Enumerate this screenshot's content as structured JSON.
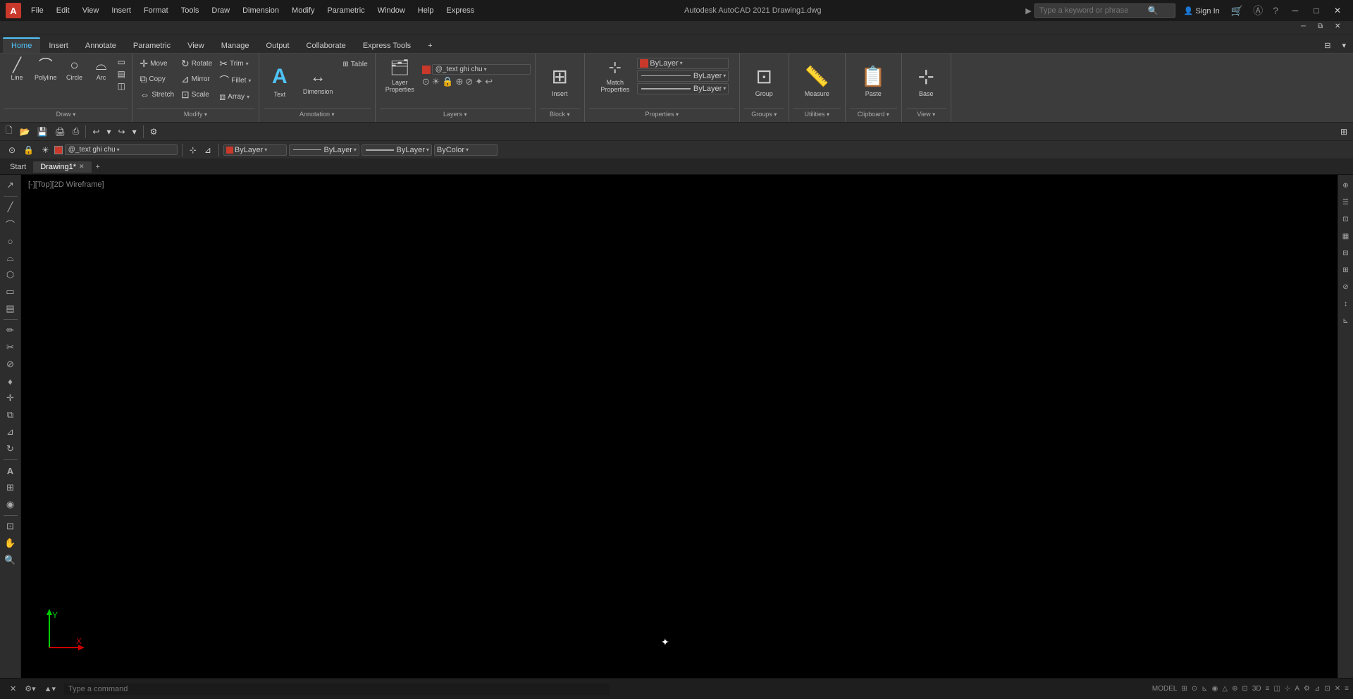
{
  "titlebar": {
    "app_letter": "A",
    "menu_items": [
      "File",
      "Edit",
      "View",
      "Insert",
      "Format",
      "Tools",
      "Draw",
      "Dimension",
      "Modify",
      "Parametric",
      "Window",
      "Help",
      "Express"
    ],
    "title": "Autodesk AutoCAD 2021   Drawing1.dwg",
    "search_placeholder": "Type a keyword or phrase",
    "sign_in": "Sign In",
    "window_controls": [
      "─",
      "□",
      "✕"
    ]
  },
  "ribbon_tabs": {
    "tabs": [
      "Home",
      "Insert",
      "Annotate",
      "Parametric",
      "View",
      "Manage",
      "Output",
      "Collaborate",
      "Express Tools"
    ],
    "active": "Home",
    "right": [
      "⊞",
      "▾"
    ]
  },
  "ribbon": {
    "draw_group": {
      "label": "Draw",
      "buttons": [
        {
          "icon": "╱",
          "label": "Line"
        },
        {
          "icon": "⌒",
          "label": "Polyline"
        },
        {
          "icon": "○",
          "label": "Circle"
        },
        {
          "icon": "⌓",
          "label": "Arc"
        }
      ],
      "more_icon": "▾"
    },
    "modify_group": {
      "label": "Modify",
      "buttons": [
        {
          "icon": "✛",
          "label": "Move"
        },
        {
          "icon": "↻",
          "label": "Rotate"
        },
        {
          "icon": "✂",
          "label": "Trim"
        },
        {
          "icon": "▤",
          "label": "Copy"
        },
        {
          "icon": "⊿",
          "label": "Mirror"
        },
        {
          "icon": "⊞",
          "label": "Fillet"
        },
        {
          "icon": "⇔",
          "label": "Stretch"
        },
        {
          "icon": "⊡",
          "label": "Scale"
        },
        {
          "icon": "⧈",
          "label": "Array"
        }
      ],
      "more_icon": "▾"
    },
    "annotation_group": {
      "label": "Annotation",
      "buttons": [
        {
          "icon": "T",
          "label": "Text"
        },
        {
          "icon": "↔",
          "label": "Dimension"
        },
        {
          "icon": "⊞",
          "label": "Table"
        }
      ]
    },
    "layers_group": {
      "label": "Layers",
      "layer_name": "@_text ghi chu",
      "buttons": []
    },
    "block_group": {
      "label": "Block",
      "insert_label": "Insert"
    },
    "properties_group": {
      "label": "Properties",
      "layer_properties_label": "Layer\nProperties",
      "match_properties_label": "Match\nProperties",
      "bylayer": "ByLayer"
    },
    "groups_group": {
      "label": "Groups",
      "group_label": "Group"
    },
    "utilities_group": {
      "label": "Utilities",
      "measure_label": "Measure"
    },
    "clipboard_group": {
      "label": "Clipboard",
      "paste_label": "Paste"
    },
    "view_group": {
      "label": "View",
      "base_label": "Base"
    }
  },
  "toolbar1": {
    "buttons": [
      "🗋",
      "📂",
      "💾",
      "🖨",
      "⎙",
      "✦",
      "📋",
      "🔙",
      "🔁",
      "↩",
      "↪",
      "⚙"
    ]
  },
  "toolbar2": {
    "layer_name": "@_text ghi chu",
    "color": "ByLayer",
    "linetype": "ByLayer",
    "lineweight": "ByLayer",
    "transparency": "ByColor"
  },
  "tab_bar": {
    "tabs": [
      {
        "label": "Start",
        "active": false
      },
      {
        "label": "Drawing1*",
        "active": true,
        "closeable": true
      }
    ],
    "add_label": "+"
  },
  "canvas": {
    "view_label": "[-][Top][2D Wireframe]"
  },
  "status_bar": {
    "command_placeholder": "Type a command",
    "close_icon": "✕",
    "settings_icon": "⚙",
    "expand_icon": "▲"
  },
  "left_toolbar": {
    "icons": [
      "↗",
      "╱",
      "⌒",
      "○",
      "⌓",
      "⬡",
      "▭",
      "⊕",
      "✏",
      "≋",
      "⊘",
      "♦",
      "△",
      "⇡",
      "⊾",
      "⊿",
      "✎",
      "⊞",
      "⊡",
      "A",
      "◉",
      "⊗"
    ]
  },
  "right_toolbar": {
    "icons": [
      "⊕",
      "☰",
      "⊡",
      "▦",
      "⊟",
      "⊞",
      "⊘",
      "↕",
      "⊾"
    ]
  },
  "colors": {
    "accent": "#4fc3f7",
    "bg_dark": "#1a1a1a",
    "bg_ribbon": "#3c3c3c",
    "canvas_bg": "#000000",
    "layer_color": "#c8392b"
  }
}
